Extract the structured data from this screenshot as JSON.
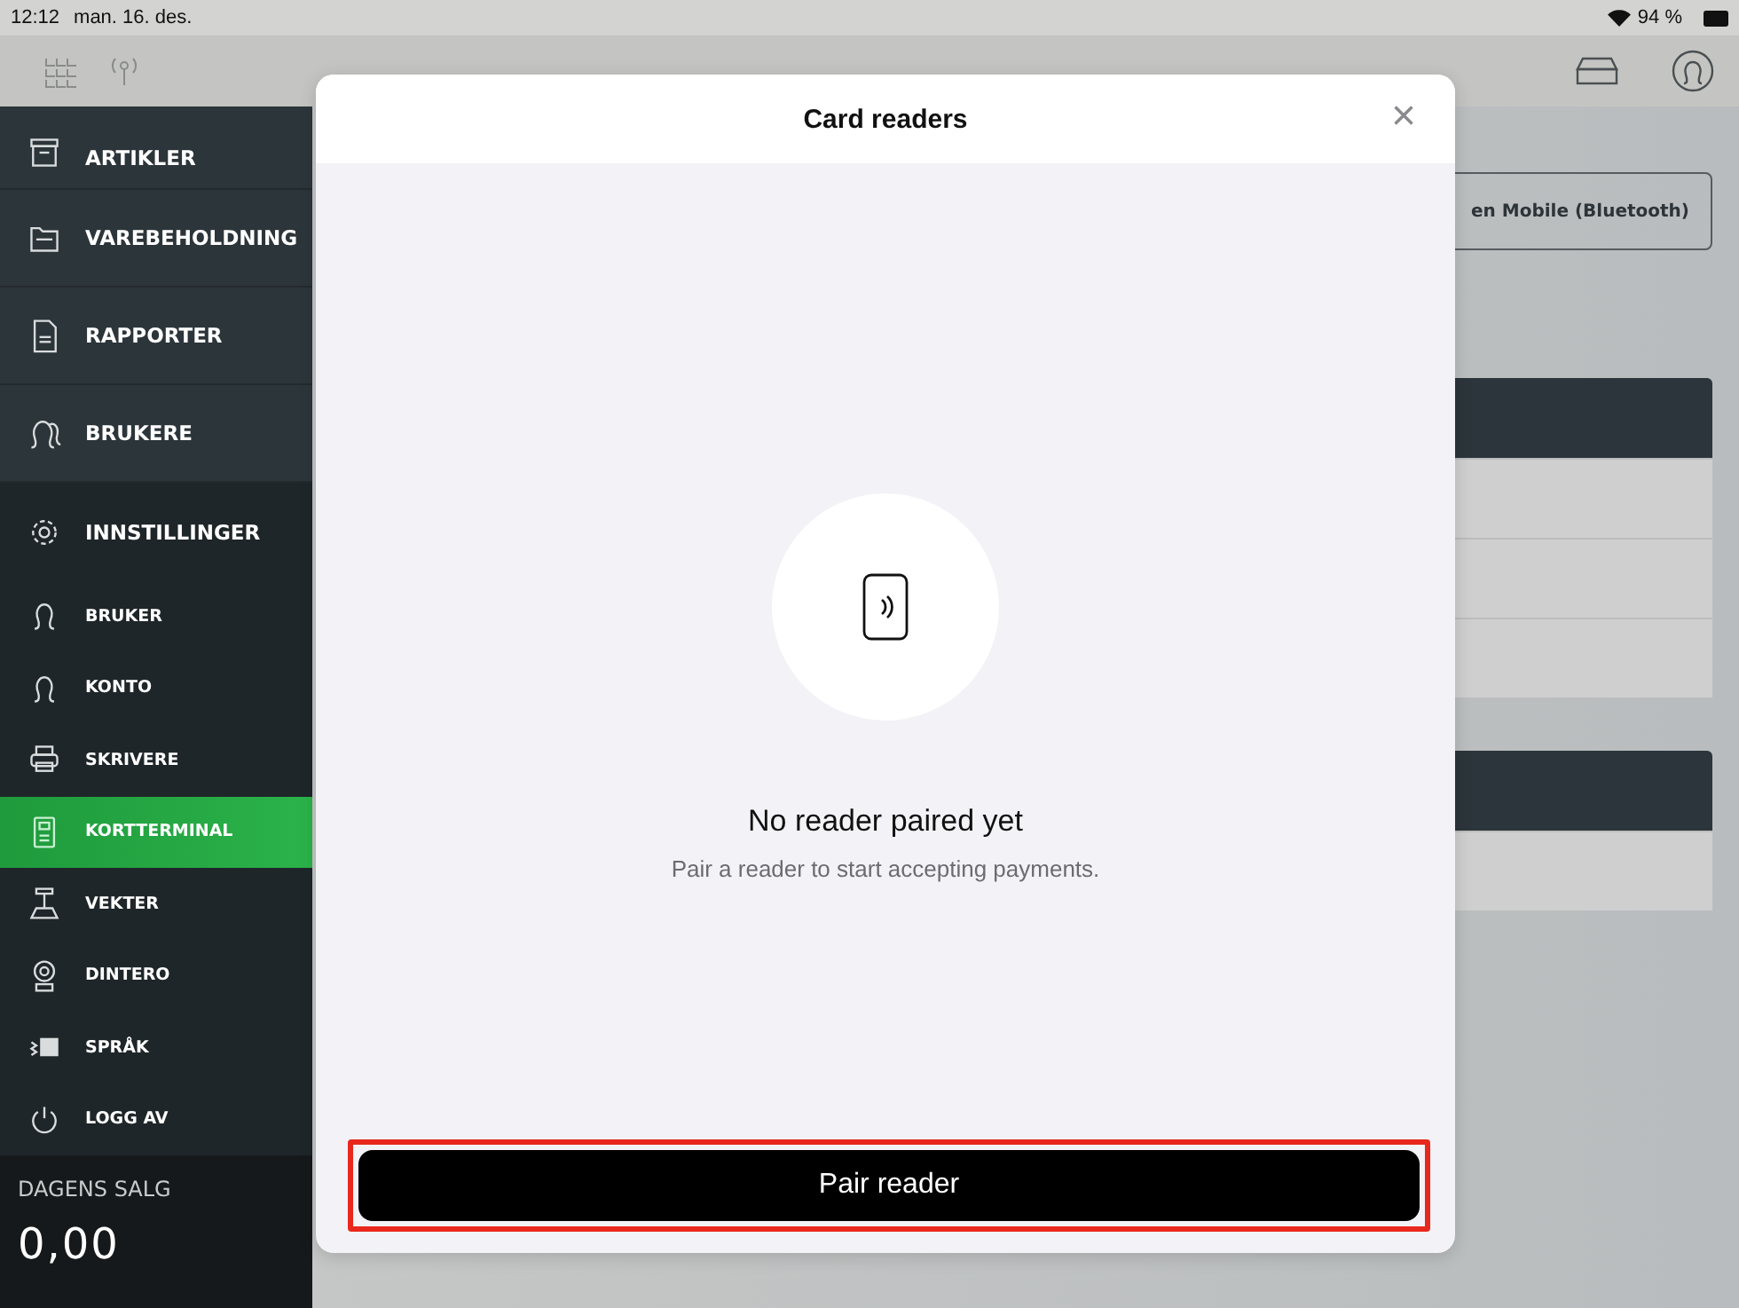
{
  "status_bar": {
    "time": "12:12",
    "date": "man. 16. des.",
    "battery": "94 %"
  },
  "sidebar": {
    "items": [
      {
        "label": "ARTIKLER",
        "kind": "main",
        "selected": false
      },
      {
        "label": "VAREBEHOLDNING",
        "kind": "main",
        "selected": false
      },
      {
        "label": "RAPPORTER",
        "kind": "main",
        "selected": false
      },
      {
        "label": "BRUKERE",
        "kind": "main",
        "selected": false
      },
      {
        "label": "INNSTILLINGER",
        "kind": "section",
        "selected": false
      },
      {
        "label": "BRUKER",
        "kind": "sub",
        "selected": false
      },
      {
        "label": "KONTO",
        "kind": "sub",
        "selected": false
      },
      {
        "label": "SKRIVERE",
        "kind": "sub",
        "selected": false
      },
      {
        "label": "KORTTERMINAL",
        "kind": "sub",
        "selected": true
      },
      {
        "label": "VEKTER",
        "kind": "sub",
        "selected": false
      },
      {
        "label": "DINTERO",
        "kind": "sub",
        "selected": false
      },
      {
        "label": "SPRÅK",
        "kind": "sub",
        "selected": false
      },
      {
        "label": "LOGG AV",
        "kind": "sub",
        "selected": false
      }
    ],
    "sales": {
      "label": "DAGENS SALG",
      "value": "0,00"
    }
  },
  "main": {
    "connect_button": "en Mobile (Bluetooth)"
  },
  "modal": {
    "title": "Card readers",
    "close": "×",
    "empty_title": "No reader paired yet",
    "empty_text": "Pair a reader to start accepting payments.",
    "pair_button": {
      "label": "Pair reader",
      "highlighted": true
    }
  }
}
